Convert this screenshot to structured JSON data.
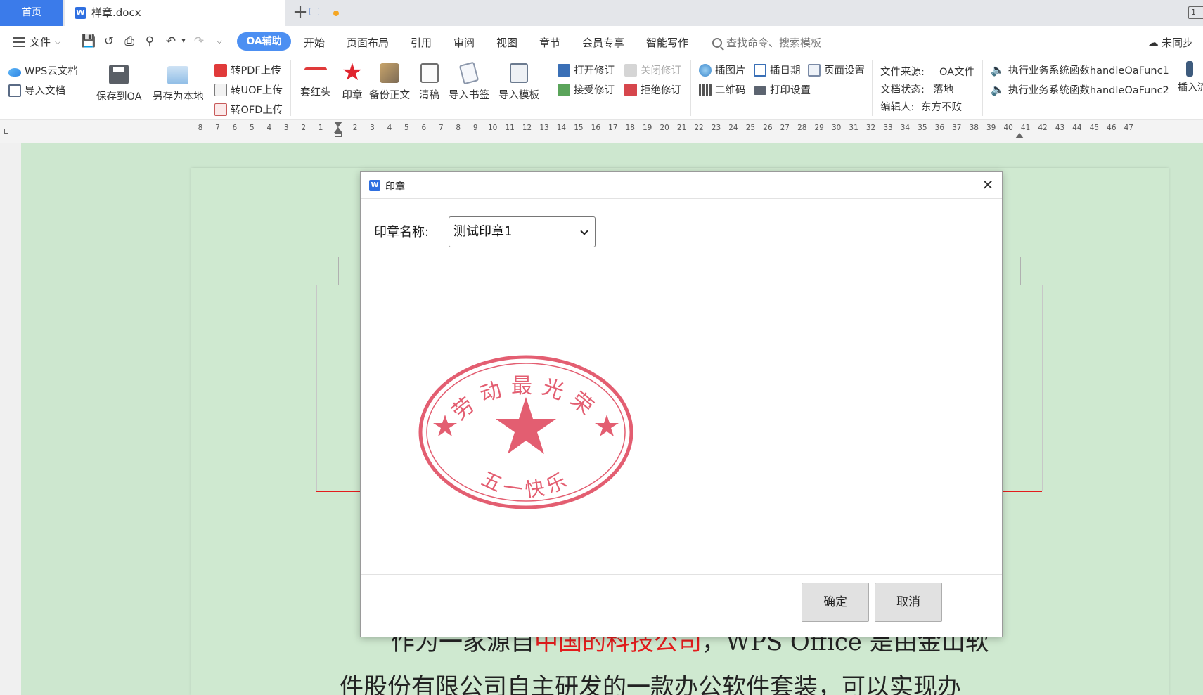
{
  "tabs": {
    "home": "首页",
    "doc_title": "样章.docx",
    "corner_label": "1"
  },
  "menubar": {
    "file": "文件",
    "items": [
      "OA辅助",
      "开始",
      "页面布局",
      "引用",
      "审阅",
      "视图",
      "章节",
      "会员专享",
      "智能写作"
    ],
    "search_placeholder": "查找命令、搜索模板",
    "sync": "未同步"
  },
  "ribbon": {
    "wps_cloud": "WPS云文档",
    "import_doc": "导入文档",
    "save_oa": "保存到OA",
    "save_local": "另存为本地",
    "to_pdf": "转PDF上传",
    "to_uof": "转UOF上传",
    "to_ofd": "转OFD上传",
    "red_header": "套红头",
    "seal": "印章",
    "backup": "备份正文",
    "clean": "清稿",
    "import_bookmark": "导入书签",
    "import_template": "导入模板",
    "open_rev": "打开修订",
    "close_rev": "关闭修订",
    "accept_rev": "接受修订",
    "reject_rev": "拒绝修订",
    "insert_pic": "插图片",
    "insert_date": "插日期",
    "page_setup": "页面设置",
    "qrcode": "二维码",
    "print_setup": "打印设置",
    "src_label": "文件来源:",
    "src_value": "OA文件",
    "status_label": "文档状态:",
    "status_value": "落地",
    "editor_label": "编辑人:",
    "editor_value": "东方不败",
    "func1": "执行业务系统函数handleOaFunc1",
    "func2": "执行业务系统函数handleOaFunc2",
    "insert_more": "插入流"
  },
  "ruler": [
    "8",
    "7",
    "6",
    "5",
    "4",
    "3",
    "2",
    "1",
    "1",
    "2",
    "3",
    "4",
    "5",
    "6",
    "7",
    "8",
    "9",
    "10",
    "11",
    "12",
    "13",
    "14",
    "15",
    "16",
    "17",
    "18",
    "19",
    "20",
    "21",
    "22",
    "23",
    "24",
    "25",
    "26",
    "27",
    "28",
    "29",
    "30",
    "31",
    "32",
    "33",
    "34",
    "35",
    "36",
    "37",
    "38",
    "39",
    "40",
    "41",
    "42",
    "43",
    "44",
    "45",
    "46",
    "47"
  ],
  "document": {
    "line1_a": "作为一家源自",
    "line1_red": "中国的科技公司",
    "line1_b": "，WPS Office 是由金山软",
    "line2": "件股份有限公司自主研发的一款办公软件套装，可以实现办"
  },
  "dialog": {
    "title": "印章",
    "label": "印章名称:",
    "selected": "测试印章1",
    "stamp_top": "劳动最光荣",
    "stamp_bottom": "五一快乐",
    "ok": "确定",
    "cancel": "取消"
  },
  "colors": {
    "accent": "#3b7bea",
    "stamp": "#e0485e",
    "doc_bg": "#cde7cf",
    "red_rule": "#e31c1c"
  }
}
